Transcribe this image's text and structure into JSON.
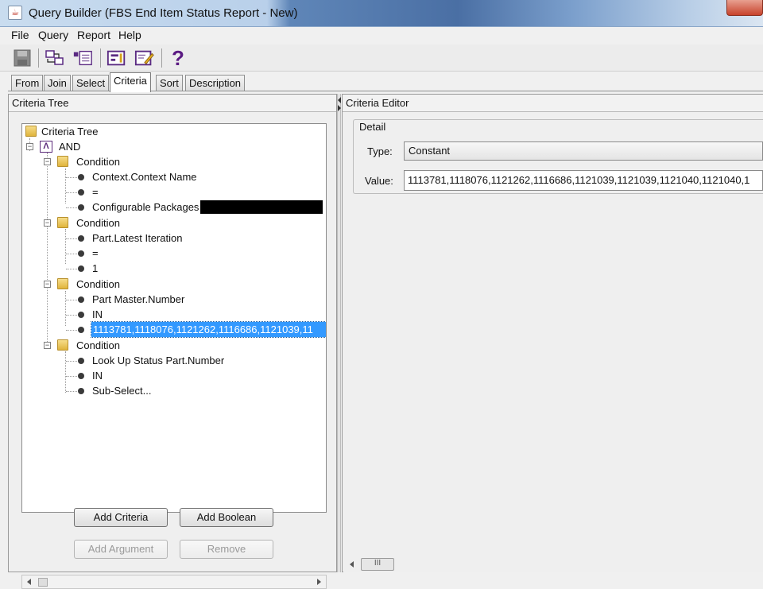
{
  "window": {
    "title": "Query Builder (FBS End Item Status Report - New)"
  },
  "menu": [
    "File",
    "Query",
    "Report",
    "Help"
  ],
  "toolbar": {
    "icons": [
      "save-icon",
      "join-icon",
      "select-icon",
      "criteria-icon",
      "edit-icon",
      "help-icon"
    ],
    "help_glyph": "?"
  },
  "tabs": [
    "From",
    "Join",
    "Select",
    "Criteria",
    "Sort",
    "Description"
  ],
  "active_tab": "Criteria",
  "left_panel": {
    "header": "Criteria Tree",
    "tree": {
      "root": "Criteria Tree",
      "boolean_op": "AND",
      "and_glyph": "Λ",
      "conditions": [
        {
          "label": "Condition",
          "items": [
            "Context.Context Name",
            "=",
            "Configurable Packages"
          ]
        },
        {
          "label": "Condition",
          "items": [
            "Part.Latest Iteration",
            "=",
            "1"
          ]
        },
        {
          "label": "Condition",
          "items": [
            "Part Master.Number",
            "IN",
            "1113781,1118076,1121262,1116686,1121039,11"
          ]
        },
        {
          "label": "Condition",
          "items": [
            "Look Up Status Part.Number",
            "IN",
            "Sub-Select..."
          ]
        }
      ]
    },
    "buttons": {
      "add_criteria": "Add Criteria",
      "add_boolean": "Add Boolean",
      "add_argument": "Add Argument",
      "remove": "Remove"
    }
  },
  "right_panel": {
    "header": "Criteria Editor",
    "detail": {
      "legend": "Detail",
      "type_label": "Type:",
      "type_value": "Constant",
      "value_label": "Value:",
      "value_text": "1113781,1118076,1121262,1116686,1121039,1121039,1121040,1121040,1"
    },
    "scroll_thumb": "III"
  }
}
